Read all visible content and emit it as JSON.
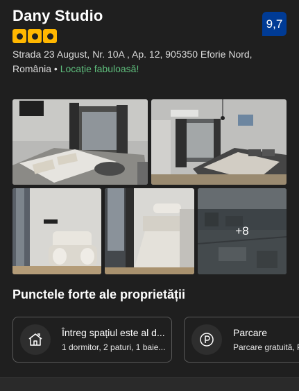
{
  "property": {
    "name": "Dany Studio",
    "rating_stars": 3,
    "score": "9,7",
    "address": "Strada 23 August, Nr. 10A , Ap. 12, 905350 Eforie Nord, România",
    "separator": "•",
    "location_label": "Locație fabuloasă!"
  },
  "gallery": {
    "more_count": "+8"
  },
  "highlights": {
    "title": "Punctele forte ale proprietății",
    "cards": [
      {
        "icon": "house-icon",
        "title": "Întreg spațiul este al d...",
        "subtitle": "1 dormitor, 2 paturi, 1 baie..."
      },
      {
        "icon": "parking-icon",
        "title": "Parcare",
        "subtitle": "Parcare gratuită, P"
      }
    ]
  },
  "colors": {
    "background": "#1f1f1f",
    "star": "#ffb700",
    "score_badge": "#003b95",
    "location_green": "#5fbf7d"
  }
}
